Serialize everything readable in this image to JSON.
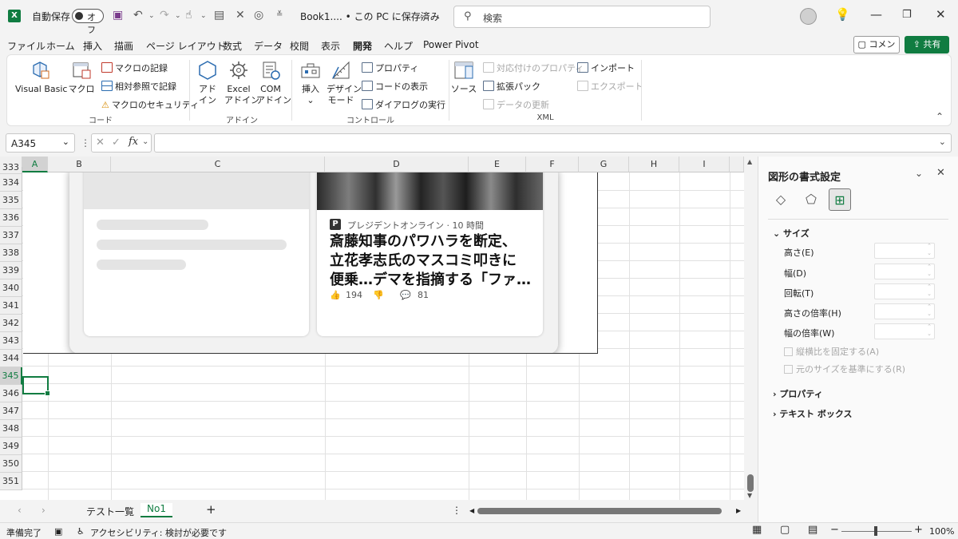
{
  "titlebar": {
    "autosave_label": "自動保存",
    "autosave_state": "オフ",
    "doc_title": "Book1.... • この PC に保存済み",
    "search_placeholder": "検索"
  },
  "menu": {
    "tabs": [
      "ファイル",
      "ホーム",
      "挿入",
      "描画",
      "ページ レイアウト",
      "数式",
      "データ",
      "校閲",
      "表示",
      "開発",
      "ヘルプ",
      "Power Pivot"
    ],
    "active": "開発",
    "comment": "コメント",
    "share": "共有"
  },
  "ribbon": {
    "code": {
      "label": "コード",
      "visual_basic": "Visual Basic",
      "macro": "マクロ",
      "record": "マクロの記録",
      "relative": "相対参照で記録",
      "security": "マクロのセキュリティ"
    },
    "addins": {
      "label": "アドイン",
      "addin": [
        "アド",
        "イン"
      ],
      "excel_addin": [
        "Excel",
        "アドイン"
      ],
      "com_addin": [
        "COM",
        "アドイン"
      ]
    },
    "controls": {
      "label": "コントロール",
      "insert": "挿入",
      "design_mode": [
        "デザイン",
        "モード"
      ],
      "properties": "プロパティ",
      "view_code": "コードの表示",
      "run_dialog": "ダイアログの実行"
    },
    "xml": {
      "label": "XML",
      "source": "ソース",
      "map_properties": "対応付けのプロパティ",
      "expansion_packs": "拡張パック",
      "refresh": "データの更新",
      "import": "インポート",
      "export": "エクスポート"
    }
  },
  "formula_bar": {
    "name_box": "A345",
    "fx": "fx",
    "value": ""
  },
  "grid": {
    "columns": [
      "A",
      "B",
      "C",
      "D",
      "E",
      "F",
      "G",
      "H",
      "I"
    ],
    "rows": [
      "333",
      "334",
      "335",
      "336",
      "337",
      "338",
      "339",
      "340",
      "341",
      "342",
      "343",
      "344",
      "345",
      "346",
      "347",
      "348",
      "349",
      "350",
      "351"
    ],
    "selected_cell": "A345"
  },
  "picture": {
    "source": "プレジデントオンライン · 10 時間",
    "headline_lines": [
      "斎藤知事のパワハラを断定、",
      "立花孝志氏のマスコミ叩きに",
      "便乗…デマを指摘する「ファ…"
    ],
    "likes": "194",
    "comments": "81"
  },
  "sheets": {
    "tabs": [
      "テスト一覧",
      "No1"
    ],
    "active": "No1"
  },
  "status": {
    "ready": "準備完了",
    "accessibility": "アクセシビリティ: 検討が必要です",
    "zoom": "100%"
  },
  "panel": {
    "title": "図形の書式設定",
    "section_size": "サイズ",
    "height": "高さ(E)",
    "width": "幅(D)",
    "rotation": "回転(T)",
    "scale_height": "高さの倍率(H)",
    "scale_width": "幅の倍率(W)",
    "lock_aspect": "縦横比を固定する(A)",
    "relative_original": "元のサイズを基準にする(R)",
    "section_properties": "プロパティ",
    "section_textbox": "テキスト ボックス"
  },
  "colors": {
    "accent": "#107c41"
  }
}
